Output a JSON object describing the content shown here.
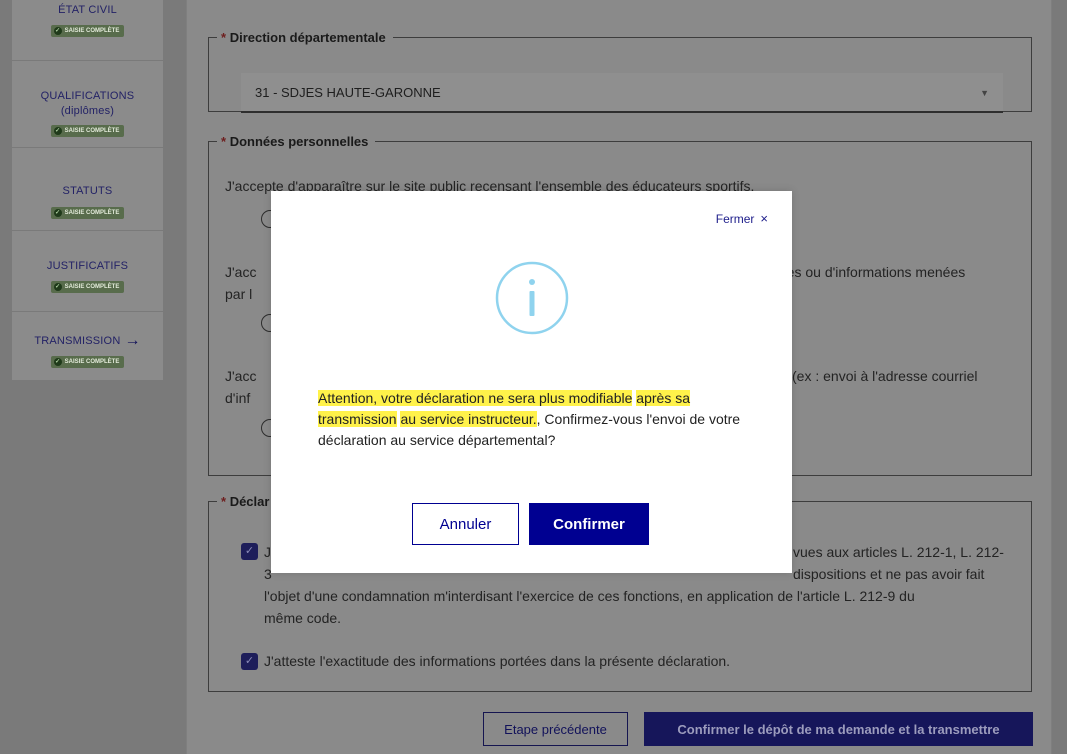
{
  "sidebar": {
    "steps": [
      {
        "title": "ÉTAT CIVIL",
        "badge": "SAISIE COMPLÈTE"
      },
      {
        "title": "QUALIFICATIONS",
        "subtitle": "(diplômes)",
        "badge": "SAISIE COMPLÈTE"
      },
      {
        "title": "STATUTS",
        "badge": "SAISIE COMPLÈTE"
      },
      {
        "title": "JUSTIFICATIFS",
        "badge": "SAISIE COMPLÈTE"
      },
      {
        "title": "TRANSMISSION",
        "badge": "SAISIE COMPLÈTE",
        "arrow": "→"
      }
    ]
  },
  "form": {
    "direction": {
      "required_mark": "*",
      "legend": "Direction départementale",
      "selected": "31 - SDJES HAUTE-GARONNE",
      "caret": "▼"
    },
    "personal": {
      "required_mark": "*",
      "legend": "Données personnelles",
      "q1": "J'accepte d'apparaître sur le site public recensant l'ensemble des éducateurs sportifs.",
      "q2_start": "J'acc",
      "q2_end": "êtes ou d'informations menées",
      "q2_line2": "par l",
      "q3_start": "J'acc",
      "q3_end": "(ex : envoi à l'adresse courriel",
      "q3_line2": "d'inf"
    },
    "declaration": {
      "required_mark": "*",
      "legend_partial": "Déclar",
      "c1_line1_frag": "J",
      "c1_line1_end": "vues aux articles L. 212-1, L. 212-",
      "c1_line2_start": "3",
      "c1_line2_end": "dispositions et ne pas avoir fait",
      "c1_line3": "l'objet d'une condamnation m'interdisant l'exercice de ces fonctions, en application de l'article L. 212-9 du",
      "c1_line4": "même code.",
      "c2": "J'atteste l'exactitude des informations portées dans la présente déclaration.",
      "check_glyph": "✓"
    },
    "buttons": {
      "previous": "Etape précédente",
      "submit": "Confirmer le dépôt de ma demande et la transmettre"
    }
  },
  "modal": {
    "close_label": "Fermer",
    "close_glyph": "×",
    "icon": "info-circle-icon",
    "message": {
      "hl1": "Attention, votre déclaration ne sera plus modifiable",
      "hl2": "après sa",
      "hl3": "transmission",
      "hl4": "au service instructeur.",
      "rest": ", Confirmez-vous l'envoi de votre déclaration au service départemental?"
    },
    "cancel": "Annuler",
    "confirm": "Confirmer"
  },
  "colors": {
    "accent": "#000091",
    "highlight": "#fff24a",
    "badge": "#586c4c"
  }
}
